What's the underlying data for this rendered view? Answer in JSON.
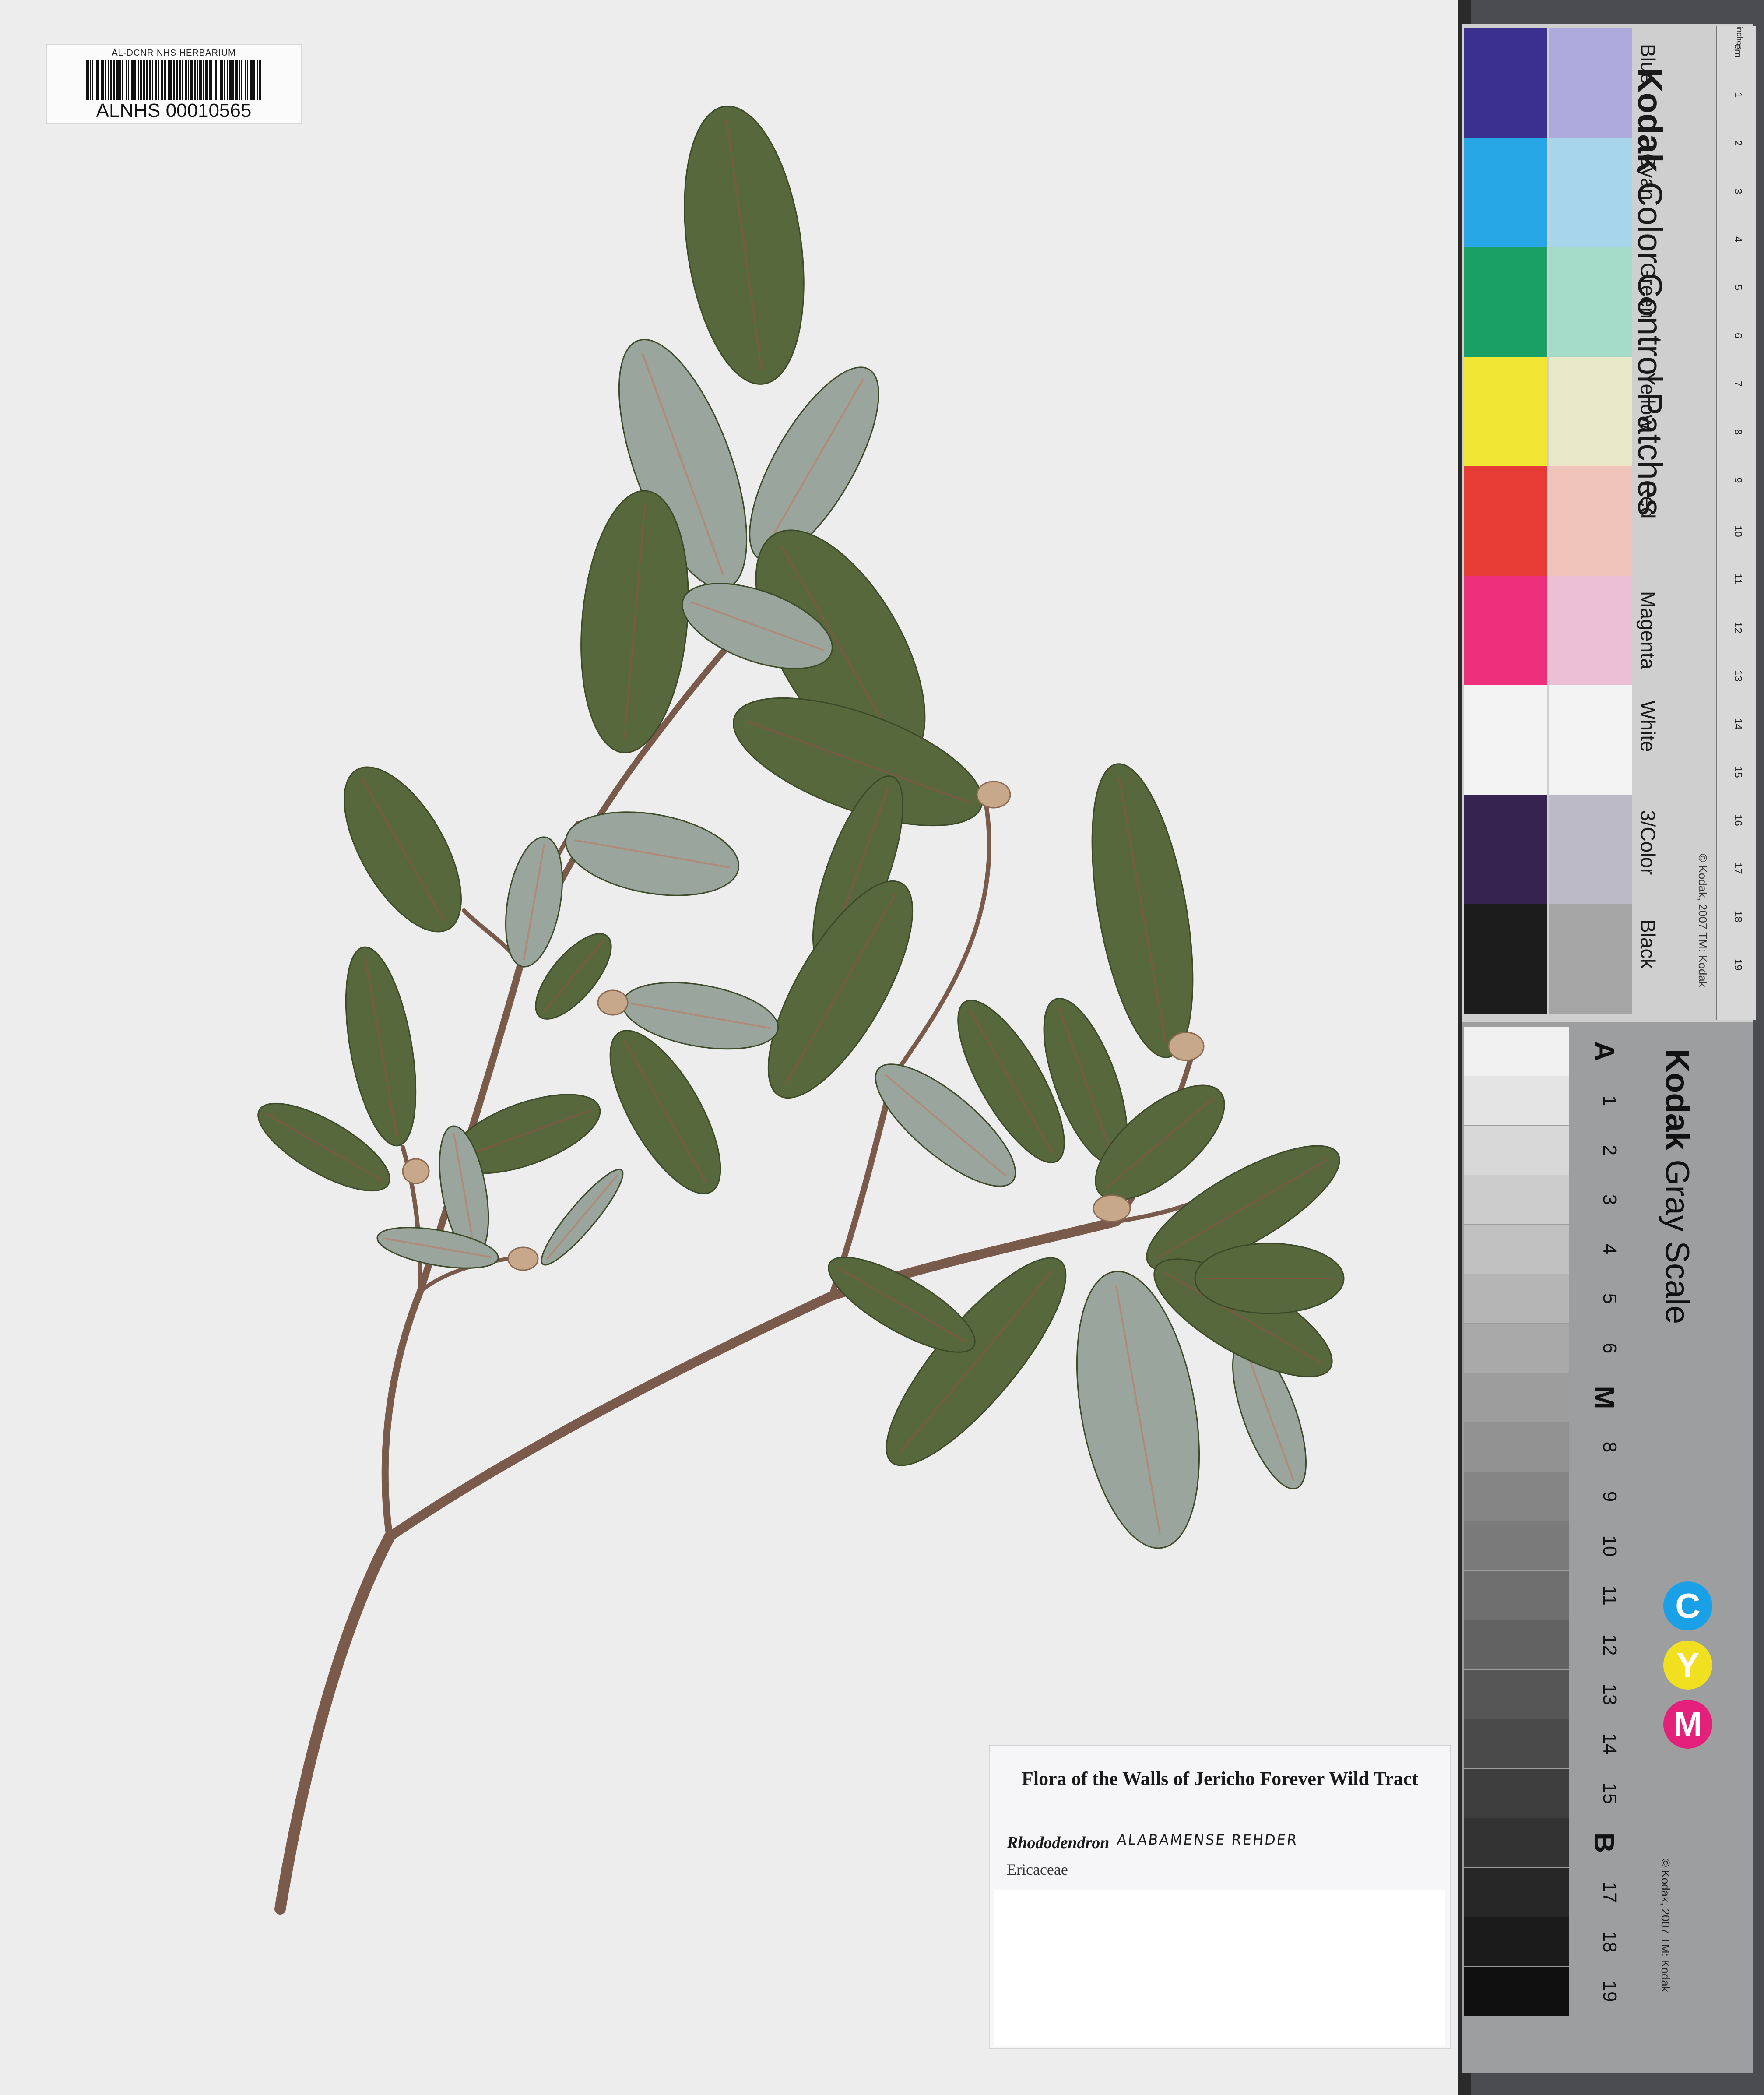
{
  "barcode": {
    "title": "AL-DCNR NHS HERBARIUM",
    "number": "ALNHS 00010565"
  },
  "label": {
    "title": "Flora of the Walls of Jericho Forever Wild Tract",
    "genus": "Rhododendron",
    "epithet_handwritten": "ALABAMENSE REHDER",
    "family": "Ericaceae"
  },
  "color_card": {
    "brand": "Kodak",
    "brand_sub": "Color Control Patches",
    "copyright": "© Kodak, 2007 TM: Kodak",
    "patches": [
      {
        "name": "Blue",
        "dark": "#3b2f8f",
        "light": "#aeaadd"
      },
      {
        "name": "Cyan",
        "dark": "#27a6e6",
        "light": "#a6d5ec"
      },
      {
        "name": "Green",
        "dark": "#1aa064",
        "light": "#a3dac8"
      },
      {
        "name": "Yellow",
        "dark": "#f1e634",
        "light": "#e9e9c9"
      },
      {
        "name": "Red",
        "dark": "#e63c35",
        "light": "#f0c3bb"
      },
      {
        "name": "Magenta",
        "dark": "#ee2f7c",
        "light": "#ecbfd6"
      },
      {
        "name": "White",
        "dark": "#f3f3f3",
        "light": "#f3f3f3"
      },
      {
        "name": "3/Color",
        "dark": "#36234f",
        "light": "#bcbac6"
      },
      {
        "name": "Black",
        "dark": "#1c1c1c",
        "light": "#a5a5a5"
      }
    ],
    "ruler_cm": [
      "cm",
      "1",
      "2",
      "3",
      "4",
      "5",
      "6",
      "7",
      "8",
      "9",
      "10",
      "11",
      "12",
      "13",
      "14",
      "15",
      "16",
      "17",
      "18",
      "19"
    ],
    "ruler_inches_label": "inches"
  },
  "gray_card": {
    "brand": "Kodak",
    "brand_sub": "Gray Scale",
    "copyright": "© Kodak, 2007 TM: Kodak",
    "steps": [
      "A",
      "1",
      "2",
      "3",
      "4",
      "5",
      "6",
      "M",
      "8",
      "9",
      "10",
      "11",
      "12",
      "13",
      "14",
      "15",
      "B",
      "17",
      "18",
      "19"
    ],
    "cym": [
      {
        "letter": "C",
        "color": "#1aa0e6"
      },
      {
        "letter": "Y",
        "color": "#f0e020"
      },
      {
        "letter": "M",
        "color": "#e5207a"
      }
    ]
  }
}
